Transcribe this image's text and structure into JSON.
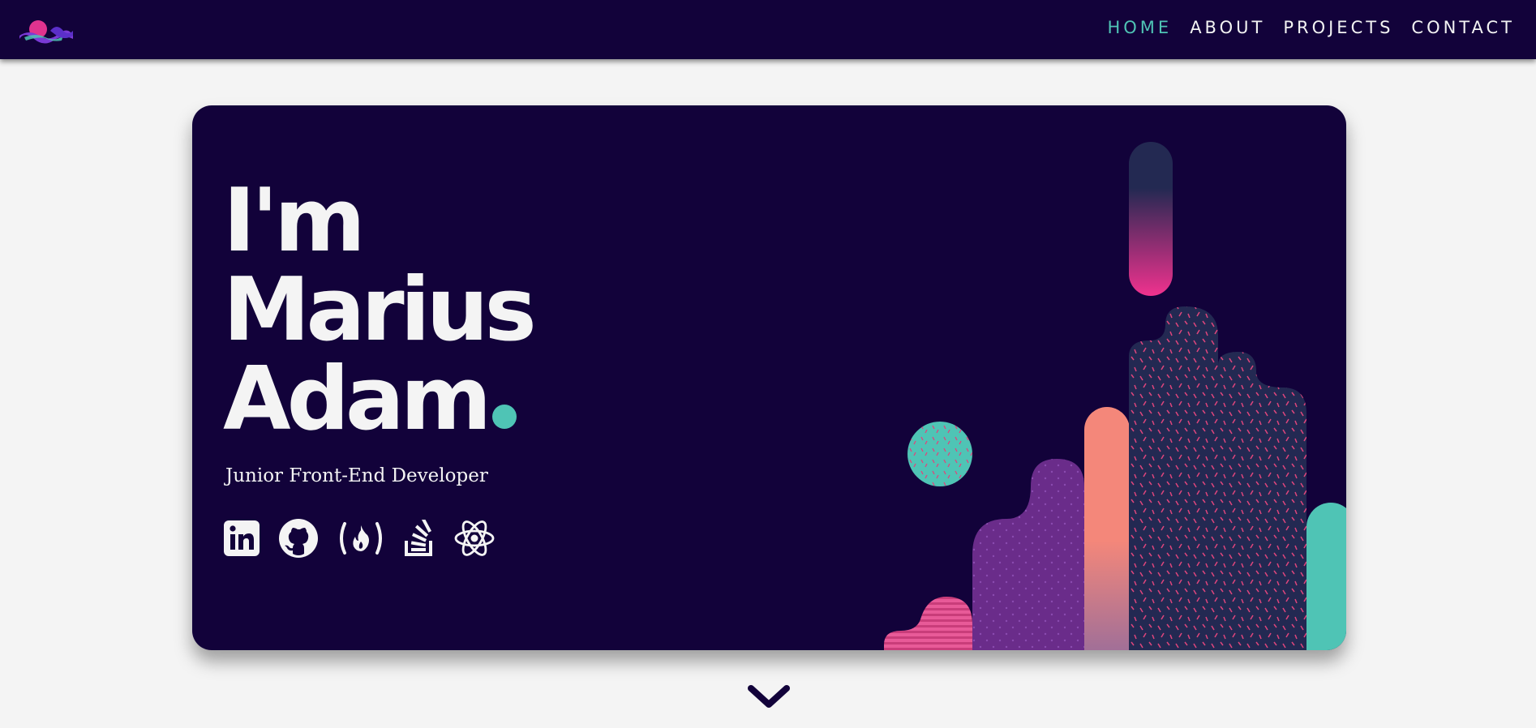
{
  "nav": {
    "logo_icon": "wave-logo-icon",
    "links": [
      {
        "label": "HOME",
        "active": true
      },
      {
        "label": "ABOUT",
        "active": false
      },
      {
        "label": "PROJECTS",
        "active": false
      },
      {
        "label": "CONTACT",
        "active": false
      }
    ]
  },
  "hero": {
    "title_lines": [
      "I'm",
      "Marius",
      "Adam"
    ],
    "subtitle": "Junior Front-End Developer",
    "social_icons": [
      "linkedin-icon",
      "github-icon",
      "freecodecamp-icon",
      "stackoverflow-icon",
      "react-icon"
    ]
  },
  "scroll_icon": "chevron-down-icon",
  "colors": {
    "navy": "#12023a",
    "teal": "#4fc4b5",
    "pink": "#f0328e",
    "coral": "#f4877a",
    "purple": "#6a2c8a",
    "slate": "#232952",
    "background": "#f4f4f4"
  }
}
